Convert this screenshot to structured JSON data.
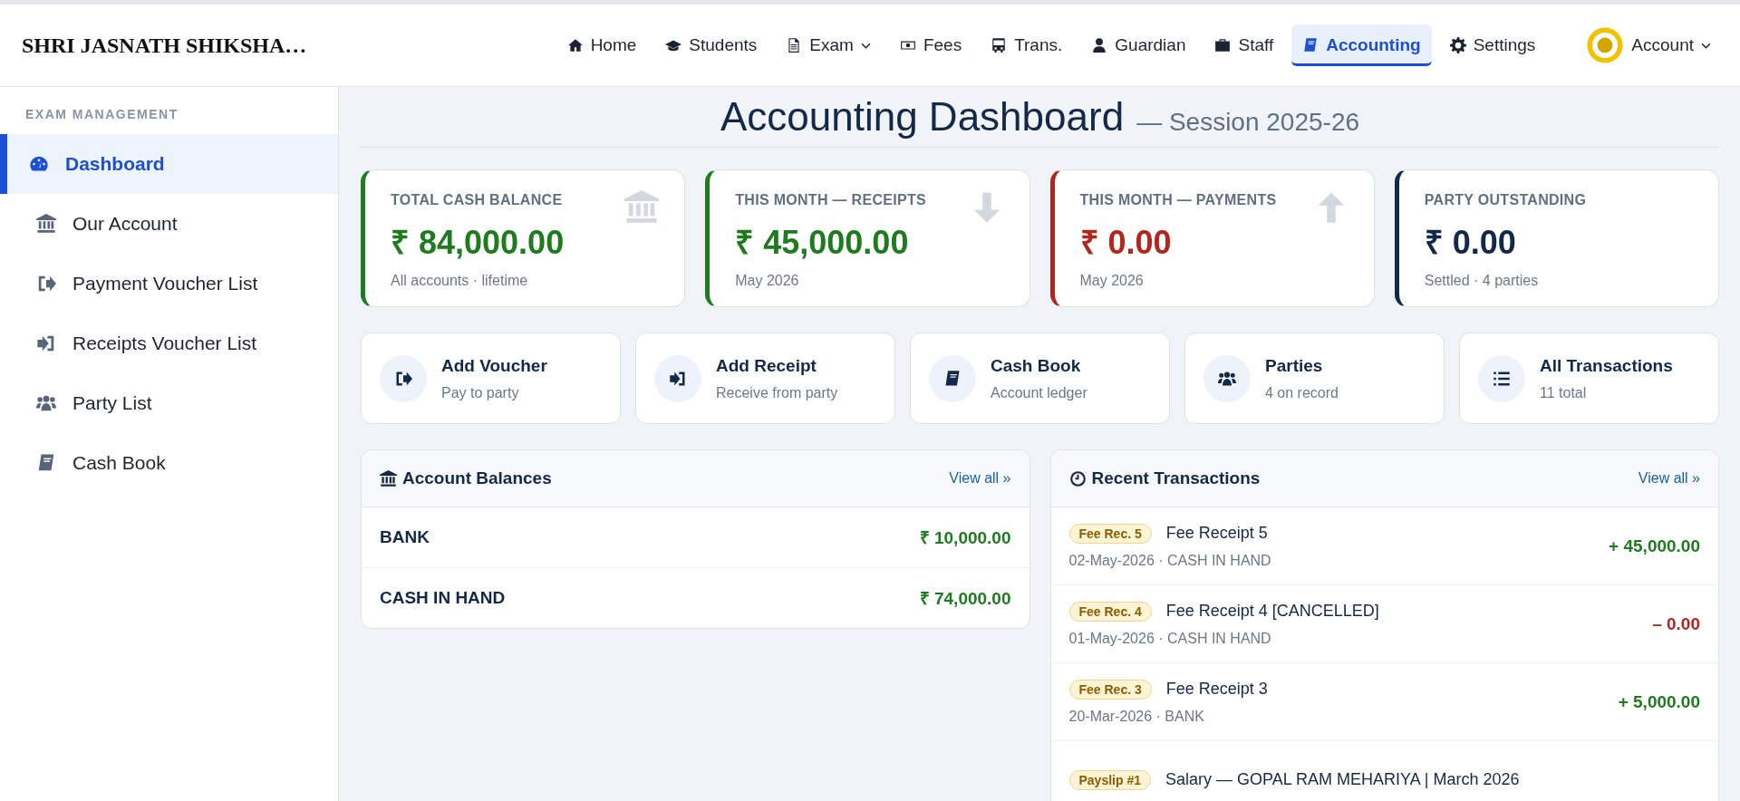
{
  "brand": "SHRI JASNATH SHIKSHA…",
  "nav": [
    {
      "label": "Home",
      "selected": false,
      "has_menu": false
    },
    {
      "label": "Students",
      "selected": false,
      "has_menu": false
    },
    {
      "label": "Exam",
      "selected": false,
      "has_menu": true
    },
    {
      "label": "Fees",
      "selected": false,
      "has_menu": false
    },
    {
      "label": "Trans.",
      "selected": false,
      "has_menu": false
    },
    {
      "label": "Guardian",
      "selected": false,
      "has_menu": false
    },
    {
      "label": "Staff",
      "selected": false,
      "has_menu": false
    },
    {
      "label": "Accounting",
      "selected": true,
      "has_menu": false
    },
    {
      "label": "Settings",
      "selected": false,
      "has_menu": false
    }
  ],
  "account": {
    "label": "Account"
  },
  "sidebar": {
    "heading": "EXAM MANAGEMENT",
    "items": [
      {
        "label": "Dashboard",
        "selected": true
      },
      {
        "label": "Our Account",
        "selected": false
      },
      {
        "label": "Payment Voucher List",
        "selected": false
      },
      {
        "label": "Receipts Voucher List",
        "selected": false
      },
      {
        "label": "Party List",
        "selected": false
      },
      {
        "label": "Cash Book",
        "selected": false
      }
    ]
  },
  "page": {
    "title": "Accounting Dashboard",
    "subtitle": "— Session 2025-26"
  },
  "stats": [
    {
      "label": "TOTAL CASH BALANCE",
      "value": "₹ 84,000.00",
      "note": "All accounts · lifetime",
      "color": "#1e7b1e"
    },
    {
      "label": "THIS MONTH — RECEIPTS",
      "value": "₹ 45,000.00",
      "note": "May 2026",
      "color": "#1e7b1e"
    },
    {
      "label": "THIS MONTH — PAYMENTS",
      "value": "₹ 0.00",
      "note": "May 2026",
      "color": "#b3261e"
    },
    {
      "label": "PARTY OUTSTANDING",
      "value": "₹ 0.00",
      "note": "Settled · 4 parties",
      "color": "#13294b"
    }
  ],
  "actions": [
    {
      "title": "Add Voucher",
      "subtitle": "Pay to party"
    },
    {
      "title": "Add Receipt",
      "subtitle": "Receive from party"
    },
    {
      "title": "Cash Book",
      "subtitle": "Account ledger"
    },
    {
      "title": "Parties",
      "subtitle": "4 on record"
    },
    {
      "title": "All Transactions",
      "subtitle": "11 total"
    }
  ],
  "balances": {
    "title": "Account Balances",
    "link": "View all »",
    "rows": [
      {
        "name": "BANK",
        "amount": "₹ 10,000.00"
      },
      {
        "name": "CASH IN HAND",
        "amount": "₹ 74,000.00"
      }
    ]
  },
  "transactions": {
    "title": "Recent Transactions",
    "link": "View all »",
    "rows": [
      {
        "tag": "Fee Rec. 5",
        "title": "Fee Receipt 5",
        "meta": "02-May-2026 · CASH IN HAND",
        "amount": "+ 45,000.00",
        "kind": "credit"
      },
      {
        "tag": "Fee Rec. 4",
        "title": "Fee Receipt 4 [CANCELLED]",
        "meta": "01-May-2026 · CASH IN HAND",
        "amount": "– 0.00",
        "kind": "debit"
      },
      {
        "tag": "Fee Rec. 3",
        "title": "Fee Receipt 3",
        "meta": "20-Mar-2026 · BANK",
        "amount": "+ 5,000.00",
        "kind": "credit"
      },
      {
        "tag": "Payslip #1",
        "title": "Salary — GOPAL RAM MEHARIYA | March 2026"
      }
    ]
  }
}
